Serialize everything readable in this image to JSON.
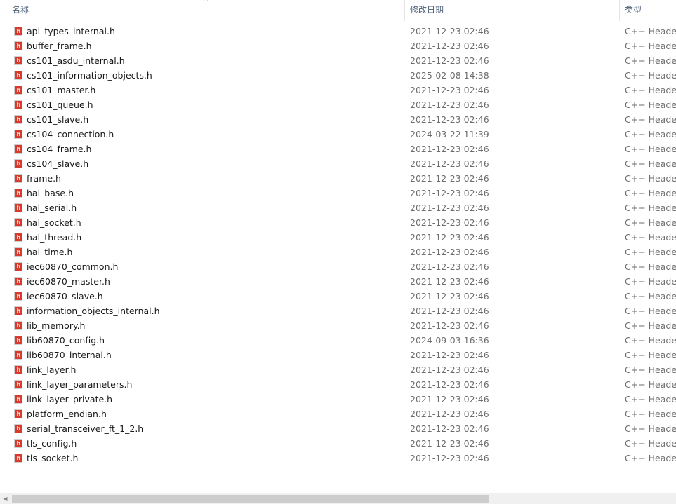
{
  "columns": {
    "name": "名称",
    "date": "修改日期",
    "type": "类型"
  },
  "files": [
    {
      "name": "apl_types_internal.h",
      "date": "2021-12-23 02:46",
      "type": "C++ Header"
    },
    {
      "name": "buffer_frame.h",
      "date": "2021-12-23 02:46",
      "type": "C++ Header"
    },
    {
      "name": "cs101_asdu_internal.h",
      "date": "2021-12-23 02:46",
      "type": "C++ Header"
    },
    {
      "name": "cs101_information_objects.h",
      "date": "2025-02-08 14:38",
      "type": "C++ Header"
    },
    {
      "name": "cs101_master.h",
      "date": "2021-12-23 02:46",
      "type": "C++ Header"
    },
    {
      "name": "cs101_queue.h",
      "date": "2021-12-23 02:46",
      "type": "C++ Header"
    },
    {
      "name": "cs101_slave.h",
      "date": "2021-12-23 02:46",
      "type": "C++ Header"
    },
    {
      "name": "cs104_connection.h",
      "date": "2024-03-22 11:39",
      "type": "C++ Header"
    },
    {
      "name": "cs104_frame.h",
      "date": "2021-12-23 02:46",
      "type": "C++ Header"
    },
    {
      "name": "cs104_slave.h",
      "date": "2021-12-23 02:46",
      "type": "C++ Header"
    },
    {
      "name": "frame.h",
      "date": "2021-12-23 02:46",
      "type": "C++ Header"
    },
    {
      "name": "hal_base.h",
      "date": "2021-12-23 02:46",
      "type": "C++ Header"
    },
    {
      "name": "hal_serial.h",
      "date": "2021-12-23 02:46",
      "type": "C++ Header"
    },
    {
      "name": "hal_socket.h",
      "date": "2021-12-23 02:46",
      "type": "C++ Header"
    },
    {
      "name": "hal_thread.h",
      "date": "2021-12-23 02:46",
      "type": "C++ Header"
    },
    {
      "name": "hal_time.h",
      "date": "2021-12-23 02:46",
      "type": "C++ Header"
    },
    {
      "name": "iec60870_common.h",
      "date": "2021-12-23 02:46",
      "type": "C++ Header"
    },
    {
      "name": "iec60870_master.h",
      "date": "2021-12-23 02:46",
      "type": "C++ Header"
    },
    {
      "name": "iec60870_slave.h",
      "date": "2021-12-23 02:46",
      "type": "C++ Header"
    },
    {
      "name": "information_objects_internal.h",
      "date": "2021-12-23 02:46",
      "type": "C++ Header"
    },
    {
      "name": "lib_memory.h",
      "date": "2021-12-23 02:46",
      "type": "C++ Header"
    },
    {
      "name": "lib60870_config.h",
      "date": "2024-09-03 16:36",
      "type": "C++ Header"
    },
    {
      "name": "lib60870_internal.h",
      "date": "2021-12-23 02:46",
      "type": "C++ Header"
    },
    {
      "name": "link_layer.h",
      "date": "2021-12-23 02:46",
      "type": "C++ Header"
    },
    {
      "name": "link_layer_parameters.h",
      "date": "2021-12-23 02:46",
      "type": "C++ Header"
    },
    {
      "name": "link_layer_private.h",
      "date": "2021-12-23 02:46",
      "type": "C++ Header"
    },
    {
      "name": "platform_endian.h",
      "date": "2021-12-23 02:46",
      "type": "C++ Header"
    },
    {
      "name": "serial_transceiver_ft_1_2.h",
      "date": "2021-12-23 02:46",
      "type": "C++ Header"
    },
    {
      "name": "tls_config.h",
      "date": "2021-12-23 02:46",
      "type": "C++ Header"
    },
    {
      "name": "tls_socket.h",
      "date": "2021-12-23 02:46",
      "type": "C++ Header"
    }
  ],
  "icons": {
    "file": "header-file-icon",
    "sort": "sort-ascending-icon",
    "scroll_left": "chevron-left-icon"
  }
}
